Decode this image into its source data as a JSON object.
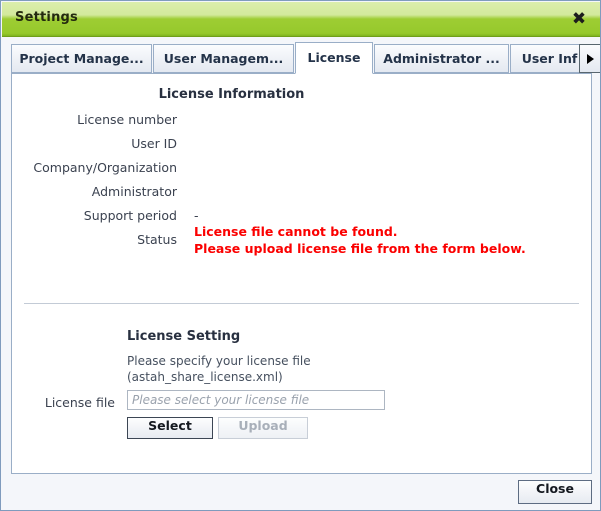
{
  "window": {
    "title": "Settings",
    "close_icon": "close-x-icon"
  },
  "tabs": [
    {
      "label": "Project Manage...",
      "active": false
    },
    {
      "label": "User Managem...",
      "active": false
    },
    {
      "label": "License",
      "active": true
    },
    {
      "label": "Administrator ...",
      "active": false
    },
    {
      "label": "User Inf",
      "active": false
    }
  ],
  "tab_scroll": {
    "right_icon": "chevron-right-icon"
  },
  "license_information": {
    "heading": "License Information",
    "rows": [
      {
        "label": "License number",
        "value": ""
      },
      {
        "label": "User ID",
        "value": ""
      },
      {
        "label": "Company/Organization",
        "value": ""
      },
      {
        "label": "Administrator",
        "value": ""
      },
      {
        "label": "Support period",
        "value": "-"
      },
      {
        "label": "Status",
        "value": ""
      }
    ],
    "status_lines": [
      "License file cannot be found.",
      "Please upload license file from the form below."
    ],
    "status_color": "#fb0000"
  },
  "license_setting": {
    "heading": "License Setting",
    "description_lines": [
      "Please specify your license file",
      "(astah_share_license.xml)"
    ],
    "file_label": "License file",
    "file_placeholder": "Please select your license file",
    "file_value": "",
    "select_label": "Select",
    "upload_label": "Upload"
  },
  "footer": {
    "close_label": "Close"
  },
  "colors": {
    "titlebar_top": "#dbeeac",
    "titlebar_bottom": "#7fb41f",
    "panel_background": "#f4f6fa",
    "border": "#9aaec7",
    "error": "#fb0000"
  }
}
